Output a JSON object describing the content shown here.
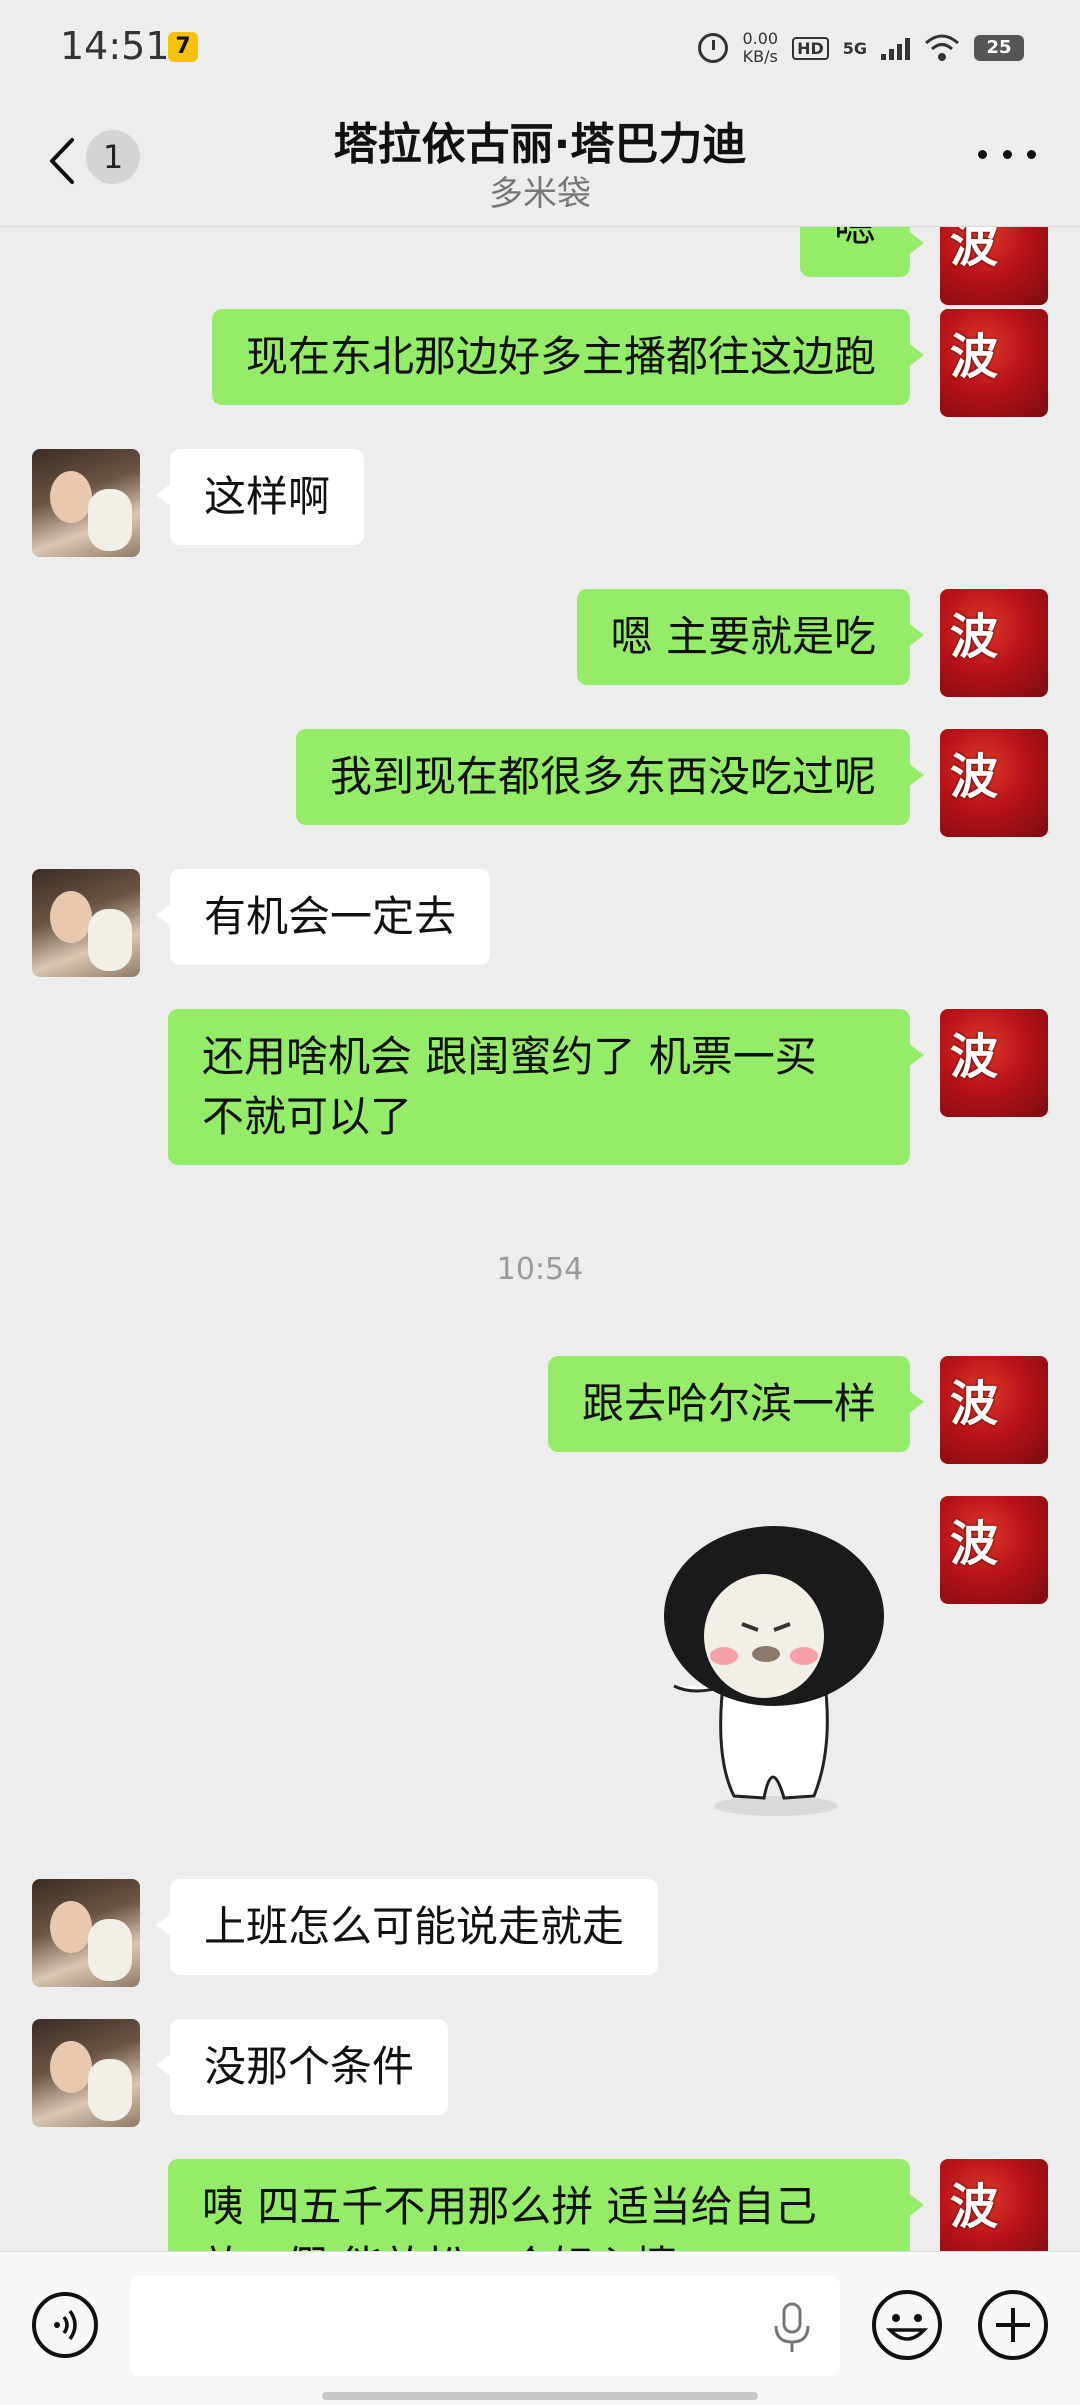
{
  "status_bar": {
    "time": "14:51",
    "net_speed_value": "0.00",
    "net_speed_unit": "KB/s",
    "hd_label": "HD",
    "network_label": "5G",
    "battery": "25"
  },
  "header": {
    "unread_count": "1",
    "title": "塔拉依古丽·塔巴力迪",
    "subtitle": "多米袋"
  },
  "avatar_me_glyph": "波",
  "messages": [
    {
      "from": "me",
      "text": "嗯"
    },
    {
      "from": "me",
      "text": "现在东北那边好多主播都往这边跑"
    },
    {
      "from": "her",
      "text": "这样啊"
    },
    {
      "from": "me",
      "text": "嗯 主要就是吃"
    },
    {
      "from": "me",
      "text": "我到现在都很多东西没吃过呢"
    },
    {
      "from": "her",
      "text": "有机会一定去"
    },
    {
      "from": "me",
      "text": "还用啥机会 跟闺蜜约了 机票一买\n不就可以了"
    },
    {
      "from": "system",
      "text": "10:54"
    },
    {
      "from": "me",
      "text": "跟去哈尔滨一样"
    },
    {
      "from": "me",
      "type": "sticker",
      "sticker_name": "mushroom-head-meme"
    },
    {
      "from": "her",
      "text": "上班怎么可能说走就走"
    },
    {
      "from": "her",
      "text": "没那个条件"
    },
    {
      "from": "me",
      "text": "咦 四五千不用那么拼 适当给自己\n放一假 能放松一个好心情"
    }
  ],
  "input_bar": {
    "placeholder": "",
    "value": ""
  },
  "icons": {
    "back": "chevron-left-icon",
    "more": "more-dots-icon",
    "voice": "voice-icon",
    "mic": "mic-icon",
    "emoji": "emoji-icon",
    "plus": "plus-icon"
  },
  "colors": {
    "background": "#ededed",
    "my_bubble": "#95ec69",
    "their_bubble": "#ffffff"
  }
}
